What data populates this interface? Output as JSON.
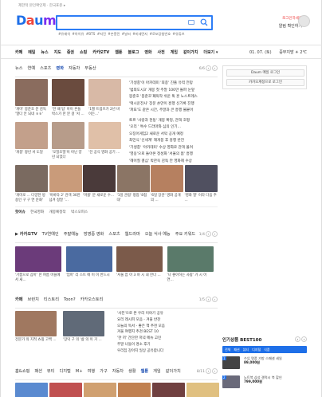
{
  "topbar": {
    "links": "제한적 본인확인제 · 한국표준 ▸"
  },
  "logo": {
    "letters": [
      "D",
      "a",
      "u",
      "m"
    ],
    "colors": [
      "#1e6fe8",
      "#f0463c",
      "#1e6fe8",
      "#7a2df0"
    ]
  },
  "search": {
    "value": "",
    "placeholder": "",
    "tags": "#유재석 #아이유 #BTS  #지진 #손흥민  #날씨 #미세먼지  #로또당첨번호  #유튜브"
  },
  "login": {
    "top": "로그인하세요",
    "name": "알림 확인하기"
  },
  "gnb": {
    "items": [
      "카페",
      "메일",
      "뉴스",
      "지도",
      "증권",
      "쇼핑",
      "카카오TV",
      "웹툰",
      "블로그",
      "영화",
      "사전",
      "게임",
      "같이가치",
      "더보기 ▾"
    ],
    "date": "01. 07. (토)",
    "weather": "중부지방 ☀ 2℃"
  },
  "news": {
    "tabs": [
      "뉴스",
      "연예",
      "스포츠",
      "영화",
      "자동차",
      "부동산"
    ],
    "active_tab": "영화",
    "pager": "6/6",
    "thumbs": [
      {
        "caption": "'개미' 봉준호 문 감독 '열다 안 되네 ㅎㅎ'",
        "color": "#8a6c5e"
      },
      {
        "caption": "'한 때 탑' 아이 흔들 박스가 한 분 걸 '서 ...",
        "color": "#6a4b3e"
      },
      {
        "caption": "'1월 트럼프가 2년 바이든...'",
        "color": "#d8b9a6"
      },
      {
        "caption": "'개봉' 왕년 서 도달",
        "color": "#c3a08b"
      },
      {
        "caption": "'오밀조밀'이 아닌 양년 되었다",
        "color": "#b79c8a"
      },
      {
        "caption": "'전 공식 영화 공기 ...",
        "color": "#e0c0a8"
      }
    ],
    "list": [
      "'기생충'이 아카데미 '최종' 진출 유력 전망",
      "'범죄도시3' 개봉 첫 주말 100만 돌파 눈앞",
      "봉준호 '봉준호'폐막작 쉬운 뚝 혼 노스트레스",
      "'택시운전사' 장문 손만이 흥행 신기록 진행",
      "'파묘'도 같은 시간, 주말과 큰 흥행 불붙어",
      "",
      "토르 '사랑과 천둥' 개봉 확정, 관객 호평",
      "'오리 ' 특수 드라마와 심의 인기...",
      "오징어게임2 새로운 서막 공개 예정",
      "최민식 '신세계' 재개봉 후 흥행 반전",
      "'기생충' '아카데미' 수상 영화로 관객 몰려",
      "'영웅'으로 돌아온 정성화 '서울의 봄' 흥행",
      "'헤어질 결심' 박찬욱 감독 칸 영화제 수상"
    ],
    "row2": [
      {
        "caption": "'개미로 ... 다양한 방송인 구 구 연 문화'",
        "color": "#7a6a60"
      },
      {
        "caption": "'아바타 2' 관객 30만 넘겨 정말 '...",
        "color": "#c99b7a"
      },
      {
        "caption": "'마블' 분 새로운 수...",
        "color": "#4a3a3a"
      },
      {
        "caption": "'1일 관람' 평점 '8점대'",
        "color": "#8b7565"
      },
      {
        "caption": "'6일 장관' 영화 공개 의 ...",
        "color": "#b68060"
      },
      {
        "caption": "'영화 열' 이라 다음 주 ...",
        "color": "#505060"
      }
    ],
    "hot_label": "핫이슈",
    "hot": [
      "한국영화",
      "개봉예정작",
      "박스오피스"
    ]
  },
  "tv": {
    "logo": "카카오TV",
    "tabs": [
      "TV연예인",
      "주말예능",
      "방영중 영화",
      "스포츠",
      "웹드라마",
      "오늘 식사 예능",
      "주요 키워드"
    ],
    "pager": "1/4",
    "cards": [
      {
        "caption": "'기쁨으로 삼아' 한 여름 마을에서 새...",
        "color": "#6b3b7a"
      },
      {
        "caption": "'엄마' 리 스트 에 이 이 반드시",
        "color": "#4a6aa0"
      },
      {
        "caption": "'서울 잡 아 3 야 시 내 한다 ...",
        "color": "#7b5a4a"
      },
      {
        "caption": "'나 좋아하는 사람' 가 시 어 연...",
        "color": "#5a7a6a"
      }
    ]
  },
  "blog": {
    "tabs": [
      "카페",
      "브런치",
      "티스토리",
      "Toon?",
      "카카오스토리"
    ],
    "pager": "1/5",
    "cards": [
      {
        "caption": "전문가 의 지적 쇼핑 고백 ...",
        "color": "#a07860"
      },
      {
        "caption": "'장덕 구 의 '삶 의 이 거 ...",
        "color": "#606a78"
      }
    ],
    "list": [
      "'사진'으로 본 우리 이야기 공유",
      "요리 레시피 모음 - 겨울 반찬",
      "오늘의 독서 - 좋은 책 추천 모음",
      "겨울 여행지 추천 BEST 10",
      "'한 끼' 간단한 저녁 메뉴 고민",
      "주말 나들이 명소 후기",
      "우리집 강아지 일상 공유합니다"
    ]
  },
  "shop": {
    "tabs": [
      "홈&쇼핑",
      "패션",
      "뷰티",
      "디지털",
      "M+",
      "여행",
      "가구",
      "자동차",
      "생활",
      "웹툰",
      "게임",
      "같이가치"
    ],
    "pager": "8/11",
    "colors": [
      "#5a8ad0",
      "#c05050",
      "#d0a070",
      "#c08050",
      "#704040",
      "#e0c080"
    ]
  },
  "right": {
    "mail_btn1": "Daum 메일 로그인",
    "mail_btn2": "카카오계정으로 로그인",
    "best_title": "인기상품 BEST100",
    "best_tabs": [
      "전체",
      "패션",
      "뷰티",
      "디지털",
      "식품"
    ],
    "items": [
      {
        "rank": "1",
        "text": "수입 명품 가방 스페셜 세일",
        "price": "89,000원",
        "color": "#444"
      },
      {
        "rank": "2",
        "text": "노트북 삼성 갤럭시 북 할인",
        "price": "799,000원",
        "color": "#6a6a7a"
      }
    ]
  }
}
